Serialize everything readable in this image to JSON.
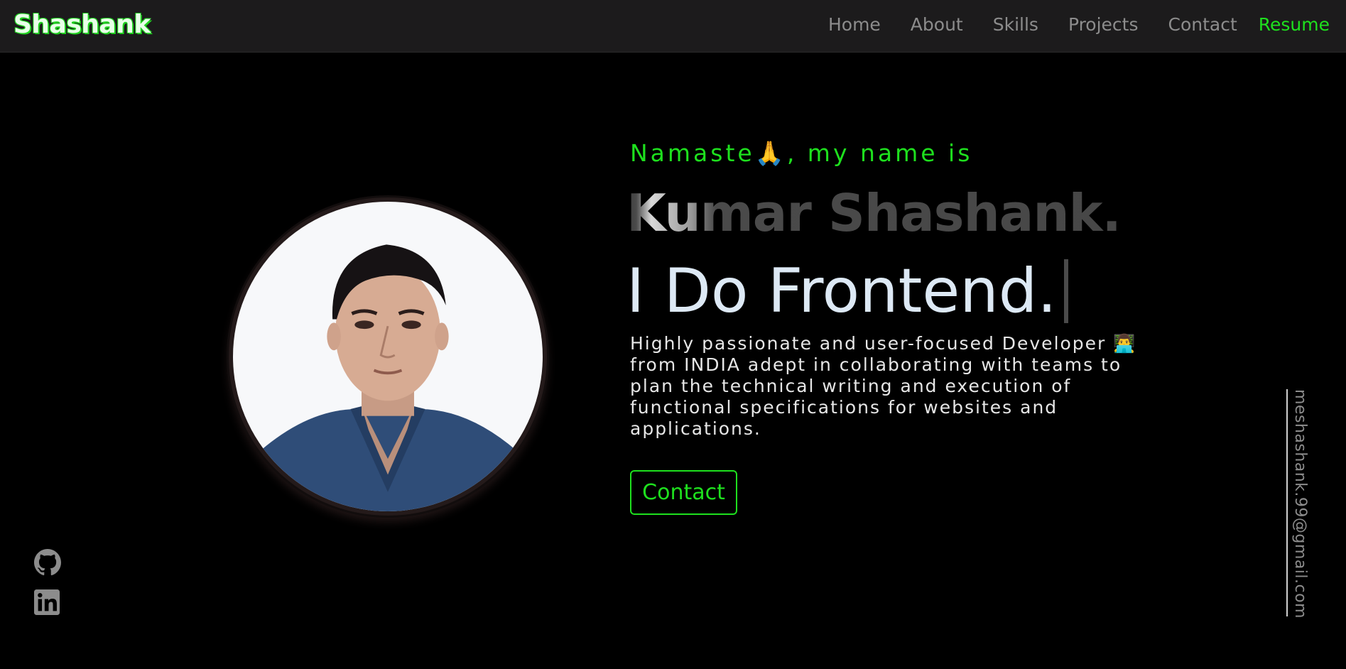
{
  "header": {
    "logo": "Shashank",
    "nav": [
      {
        "label": "Home"
      },
      {
        "label": "About"
      },
      {
        "label": "Skills"
      },
      {
        "label": "Projects"
      },
      {
        "label": "Contact"
      },
      {
        "label": "Resume"
      }
    ]
  },
  "hero": {
    "greeting_prefix": "Namaste",
    "greeting_emoji": "🙏",
    "greeting_suffix": ", my name is",
    "name": "Kumar Shashank.",
    "tagline": "I Do Frontend.",
    "bio_line1": "Highly passionate and user-focused Developer",
    "bio_emoji": "👨‍💻",
    "bio_rest": " from INDIA adept in collaborating with teams to plan the technical writing and execution of functional specifications for websites and applications.",
    "contact_button": "Contact"
  },
  "social": {
    "github_icon": "github-icon",
    "linkedin_icon": "linkedin-icon"
  },
  "email": "meshashank.99@gmail.com",
  "colors": {
    "accent": "#1ee01e",
    "nav_bg": "#1c1b1c",
    "page_bg": "#000000",
    "muted": "#8c8c8c"
  }
}
